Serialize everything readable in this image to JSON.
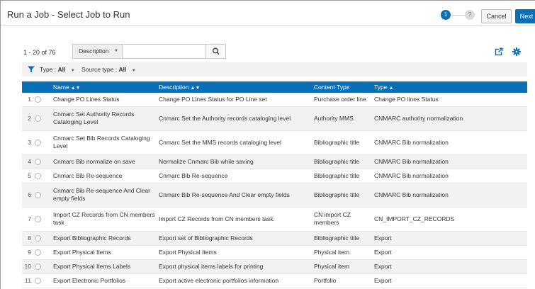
{
  "header": {
    "title": "Run a Job - Select Job to Run",
    "steps": [
      "1",
      "?"
    ],
    "cancel_label": "Cancel",
    "next_label": "Next"
  },
  "toolbar": {
    "count": "1 - 20 of 76",
    "scope_label": "Description",
    "search_value": "",
    "search_placeholder": "",
    "icons": [
      "search-icon",
      "export-icon",
      "gear-icon",
      "filter-icon"
    ]
  },
  "filters": [
    {
      "label": "Type :",
      "value": "All"
    },
    {
      "label": "Source type :",
      "value": "All"
    }
  ],
  "table": {
    "columns": [
      "Name",
      "Description",
      "Content Type",
      "Type"
    ],
    "sort_markers": [
      "▲▼",
      "▲▼",
      "",
      "▲"
    ],
    "rows": [
      {
        "num": "1",
        "name": "Change PO Lines Status",
        "description": "Change PO Lines Status for PO Line set",
        "content_type": "Purchase order line",
        "type": "Change PO lines Status"
      },
      {
        "num": "2",
        "name": "Cnmarc Set Authority Records Cataloging Level",
        "description": "Cnmarc Set the Authority records cataloging level",
        "content_type": "Authority MMS",
        "type": "CNMARC authority normalization"
      },
      {
        "num": "3",
        "name": "Cnmarc Set Bib Records Cataloging Level",
        "description": "Cnmarc Set the MMS records cataloging level",
        "content_type": "Bibliographic title",
        "type": "CNMARC Bib normalization"
      },
      {
        "num": "4",
        "name": "Cnmarc Bib normalize on save",
        "description": "Normalize Cnmarc Bib while saving",
        "content_type": "Bibliographic title",
        "type": "CNMARC Bib normalization"
      },
      {
        "num": "5",
        "name": "Cnmarc Bib Re-sequence",
        "description": "Cnmarc Bib Re-sequence",
        "content_type": "Bibliographic title",
        "type": "CNMARC Bib normalization"
      },
      {
        "num": "6",
        "name": "Cnmarc Bib Re-sequence And Clear empty fields",
        "description": "Cnmarc Bib Re-sequence And Clear empty fields",
        "content_type": "Bibliographic title",
        "type": "CNMARC Bib normalization"
      },
      {
        "num": "7",
        "name": "Import CZ Records from CN members task",
        "description": "Import CZ Records from CN members task.",
        "content_type": "CN import CZ members",
        "type": "CN_IMPORT_CZ_RECORDS"
      },
      {
        "num": "8",
        "name": "Export Bibliographic Records",
        "description": "Export set of Bibliographic Records",
        "content_type": "Bibliographic title",
        "type": "Export"
      },
      {
        "num": "9",
        "name": "Export Physical Items",
        "description": "Export Physical Items",
        "content_type": "Physical item",
        "type": "Export"
      },
      {
        "num": "10",
        "name": "Export Physical Items Labels",
        "description": "Export physical items labels for printing",
        "content_type": "Physical item",
        "type": "Export"
      },
      {
        "num": "11",
        "name": "Export Electronic Portfolios",
        "description": "Export active electronic portfolios information",
        "content_type": "Portfolio",
        "type": "Export"
      }
    ]
  },
  "colors": {
    "accent": "#0b6fb6",
    "stripe": "#f2f2f2"
  }
}
